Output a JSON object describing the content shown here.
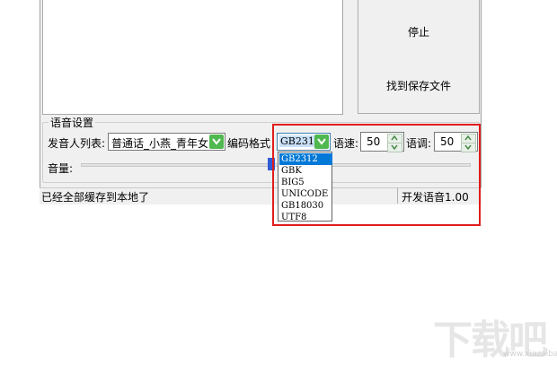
{
  "buttons": {
    "stop": "停止",
    "find_saved_file": "找到保存文件"
  },
  "voice_settings": {
    "group_title": "语音设置",
    "speaker_list_label": "发音人列表:",
    "speaker_value": "普通话_小燕_青年女",
    "encoding_label": "编码格式",
    "encoding_value": "GB2312",
    "encoding_options": [
      "GB2312",
      "GBK",
      "BIG5",
      "UNICODE",
      "GB18030",
      "UTF8"
    ],
    "speed_label": "语速:",
    "speed_value": "50",
    "pitch_label": "语调:",
    "pitch_value": "50",
    "volume_label": "音量:"
  },
  "status": {
    "left": "已经全部缓存到本地了",
    "right": "开发语音1.00"
  },
  "watermark": {
    "text": "下载吧",
    "url": "www.xiazaiba.com"
  },
  "colors": {
    "highlight": "#e01d1d",
    "selection": "#0078d7",
    "slider_thumb": "#2f5bd6",
    "combo_arrow": "#4fb84f"
  }
}
